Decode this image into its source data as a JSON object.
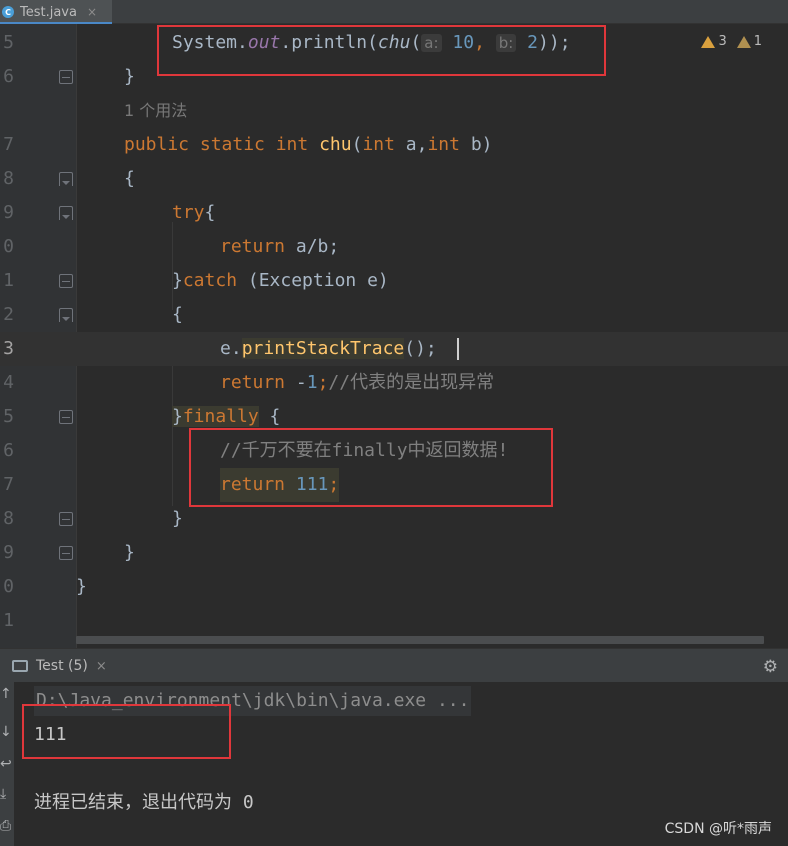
{
  "tab": {
    "file_name": "Test.java",
    "close_glyph": "×",
    "icon_letter": "C"
  },
  "inspections": {
    "warnings": "3",
    "weak_warnings": "1"
  },
  "gutter": {
    "l5": "5",
    "l6": "6",
    "l7": "7",
    "l8": "8",
    "l9": "9",
    "l10": "0",
    "l11": "1",
    "l12": "2",
    "l13": "3",
    "l14": "4",
    "l15": "5",
    "l16": "6",
    "l17": "7",
    "l18": "8",
    "l19": "9",
    "l20": "0",
    "l21": "1"
  },
  "code": {
    "sys_prefix": "System.",
    "sys_out": "out",
    "sys_dot": ".println(",
    "sys_chu": "chu",
    "sys_paren": "(",
    "hint_a": "a:",
    "arg_a": "10",
    "comma": ",",
    "hint_b": "b:",
    "arg_b": "2",
    "sys_end": "));",
    "close_brace": "}",
    "usage": "1 个用法",
    "sig_public": "public static int ",
    "sig_chu": "chu",
    "sig_open": "(",
    "sig_int1": "int",
    "sig_a": " a,",
    "sig_int2": "int",
    "sig_b": " b)",
    "open_brace": "{",
    "try_kw": "try",
    "return_kw": "return",
    "return_ab": " a/b;",
    "catch_close": "}",
    "catch_kw": "catch",
    "catch_rest": " (Exception e)",
    "print_e": "e.",
    "print_fn": "printStackTrace",
    "print_end": "();",
    "ret_neg": " -",
    "ret_one": "1",
    "ret_semi": ";",
    "ret_comment": "//代表的是出现异常",
    "finally_close": "}",
    "finally_kw": "finally",
    "finally_rest": " {",
    "comment_finally": "//千万不要在finally中返回数据!",
    "ret111_kw": "return",
    "ret111_num": " 111",
    "ret111_semi": ";"
  },
  "run": {
    "tab_label": "Test (5)",
    "close_glyph": "×",
    "gear_glyph": "⚙",
    "command": "D:\\Java_environment\\jdk\\bin\\java.exe ...",
    "output": "111",
    "exit_message": "进程已结束，退出代码为 0"
  },
  "watermark": "CSDN @听*雨声"
}
